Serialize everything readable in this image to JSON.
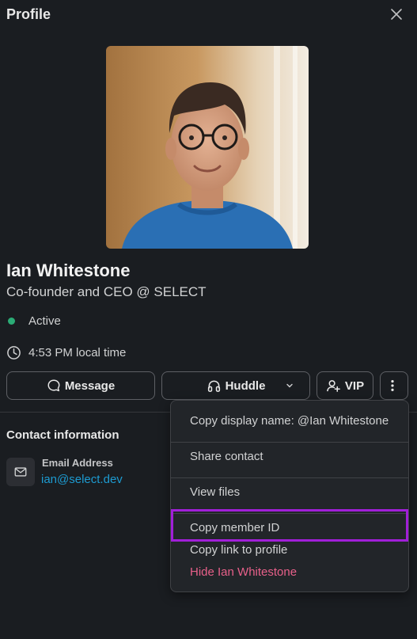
{
  "header": {
    "title": "Profile",
    "close_icon": "close-icon"
  },
  "profile": {
    "name": "Ian Whitestone",
    "title": "Co-founder and CEO @ SELECT",
    "status": "Active",
    "status_color": "#2bac76",
    "local_time": "4:53 PM local time"
  },
  "actions": {
    "message": "Message",
    "huddle": "Huddle",
    "vip": "VIP"
  },
  "contact": {
    "section_title": "Contact information",
    "email_label": "Email Address",
    "email": "ian@select.dev"
  },
  "menu": {
    "items": [
      "Copy display name: @Ian Whitestone",
      "Share contact",
      "View files",
      "Copy member ID",
      "Copy link to profile",
      "Hide Ian Whitestone"
    ],
    "highlighted_item": "Copy member ID",
    "highlight_color": "#a11fd8",
    "danger_color": "#e8608a"
  },
  "colors": {
    "background": "#1a1d21",
    "link": "#1d9bd1"
  }
}
